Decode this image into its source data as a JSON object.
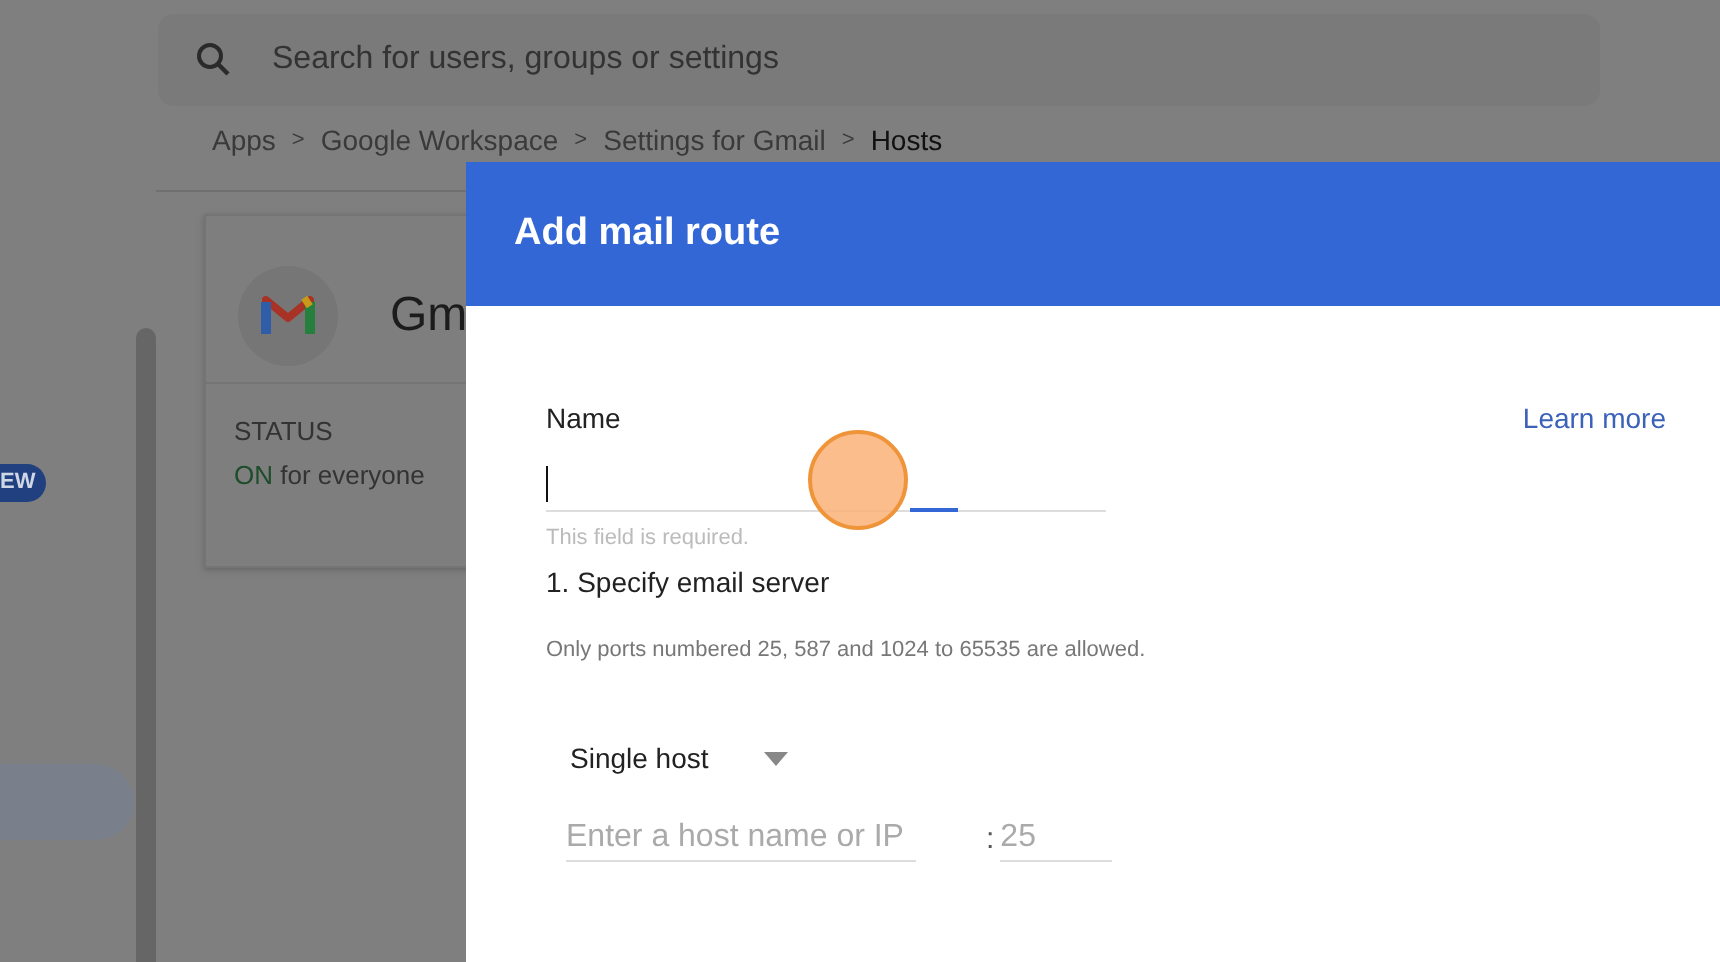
{
  "search": {
    "placeholder": "Search for users, groups or settings"
  },
  "breadcrumb": [
    {
      "label": "Apps",
      "current": false
    },
    {
      "label": "Google Workspace",
      "current": false
    },
    {
      "label": "Settings for Gmail",
      "current": false
    },
    {
      "label": "Hosts",
      "current": true
    }
  ],
  "breadcrumb_separator": ">",
  "sidebar": {
    "badge": "EW"
  },
  "app_card": {
    "title": "Gm",
    "status_label": "STATUS",
    "status_value": "ON",
    "status_detail": "for everyone"
  },
  "dialog": {
    "title": "Add mail route",
    "name_field": {
      "label": "Name",
      "focused": true,
      "helper": "This field is required."
    },
    "learn_more": "Learn more",
    "step": "1. Specify email server",
    "note": "Only ports numbered 25, 587 and 1024 to 65535 are allowed.",
    "host_type": {
      "value": "Single host"
    },
    "host_field": {
      "placeholder": "Enter a host name or IP"
    },
    "port_separator": ":",
    "port_field": {
      "placeholder": "25"
    }
  }
}
